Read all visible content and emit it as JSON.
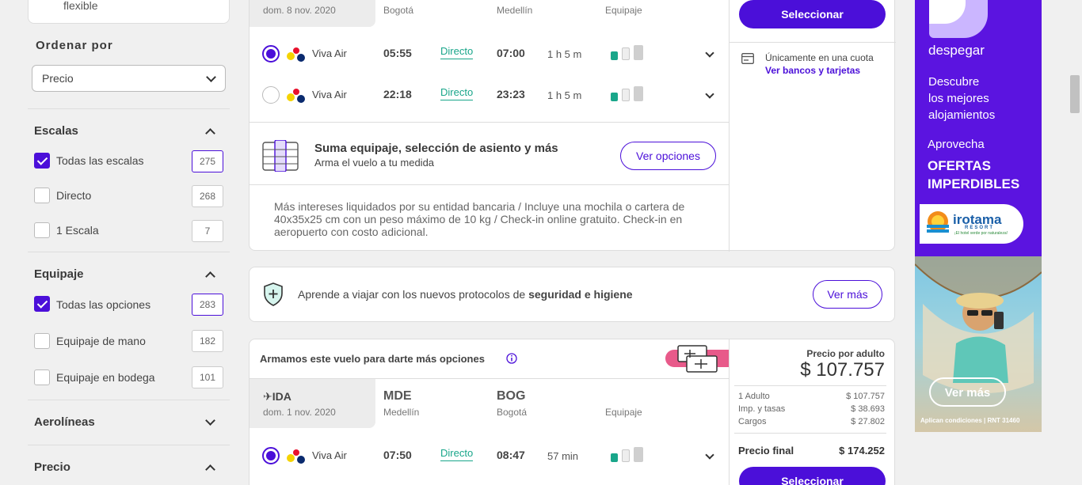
{
  "sidebar": {
    "flexible_label": "flexible",
    "sort": {
      "title": "Ordenar por",
      "selected": "Precio"
    },
    "stops": {
      "title": "Escalas",
      "options": [
        {
          "label": "Todas las escalas",
          "count": "275",
          "checked": true
        },
        {
          "label": "Directo",
          "count": "268",
          "checked": false
        },
        {
          "label": "1 Escala",
          "count": "7",
          "checked": false
        }
      ]
    },
    "baggage": {
      "title": "Equipaje",
      "options": [
        {
          "label": "Todas las opciones",
          "count": "283",
          "checked": true
        },
        {
          "label": "Equipaje de mano",
          "count": "182",
          "checked": false
        },
        {
          "label": "Equipaje en bodega",
          "count": "101",
          "checked": false
        }
      ]
    },
    "airlines_title": "Aerolíneas",
    "price_title": "Precio"
  },
  "card1": {
    "date": "dom. 8 nov. 2020",
    "from_city": "Bogotá",
    "to_city": "Medellín",
    "baggage_label": "Equipaje",
    "flights": [
      {
        "airline": "Viva Air",
        "depart": "05:55",
        "type": "Directo",
        "arrive": "07:00",
        "duration": "1 h 5 m",
        "selected": true
      },
      {
        "airline": "Viva Air",
        "depart": "22:18",
        "type": "Directo",
        "arrive": "23:23",
        "duration": "1 h 5 m",
        "selected": false
      }
    ],
    "upsell": {
      "title": "Suma equipaje, selección de asiento y más",
      "subtitle": "Arma el vuelo a tu medida",
      "button": "Ver opciones"
    },
    "note": "Más intereses liquidados por su entidad bancaria / Incluye una mochila o cartera de 40x35x25 cm con un peso máximo de 10 kg / Check-in online gratuito. Check-in en aeropuerto con costo adicional.",
    "select_button": "Seleccionar",
    "payment_text": "Únicamente en una cuota",
    "payment_link": "Ver bancos y tarjetas"
  },
  "safety": {
    "text_pre": "Aprende a viajar con los nuevos protocolos de ",
    "text_bold": "seguridad e higiene",
    "button": "Ver más"
  },
  "card2": {
    "header": "Armamos este vuelo para darte más opciones",
    "direction": "IDA",
    "date": "dom. 1 nov. 2020",
    "from_code": "MDE",
    "from_city": "Medellín",
    "to_code": "BOG",
    "to_city": "Bogotá",
    "baggage_label": "Equipaje",
    "flight": {
      "airline": "Viva Air",
      "depart": "07:50",
      "type": "Directo",
      "arrive": "08:47",
      "duration": "57 min",
      "selected": true
    },
    "price": {
      "per_adult_label": "Precio por adulto",
      "per_adult": "$ 107.757",
      "rows": [
        {
          "label": "1 Adulto",
          "value": "$ 107.757"
        },
        {
          "label": "Imp. y tasas",
          "value": "$ 38.693"
        },
        {
          "label": "Cargos",
          "value": "$ 27.802"
        }
      ],
      "final_label": "Precio final",
      "final": "$ 174.252"
    },
    "select_button": "Seleccionar"
  },
  "ad": {
    "brand": "despegar",
    "line1": "Descubre",
    "line2": "los mejores",
    "line3": "alojamientos",
    "line4": "Aprovecha",
    "line5": "OFERTAS",
    "line6": "IMPERDIBLES",
    "resort_name": "irotama",
    "resort_sub": "RESORT",
    "resort_tagline": "¡El hotel verde por naturaleza!",
    "button": "Ver más",
    "disclaimer": "Aplican condiciones | RNT 31460"
  },
  "colors": {
    "accent": "#4b0fd9",
    "green": "#19a68a",
    "ad_bg": "#5b14e0"
  }
}
